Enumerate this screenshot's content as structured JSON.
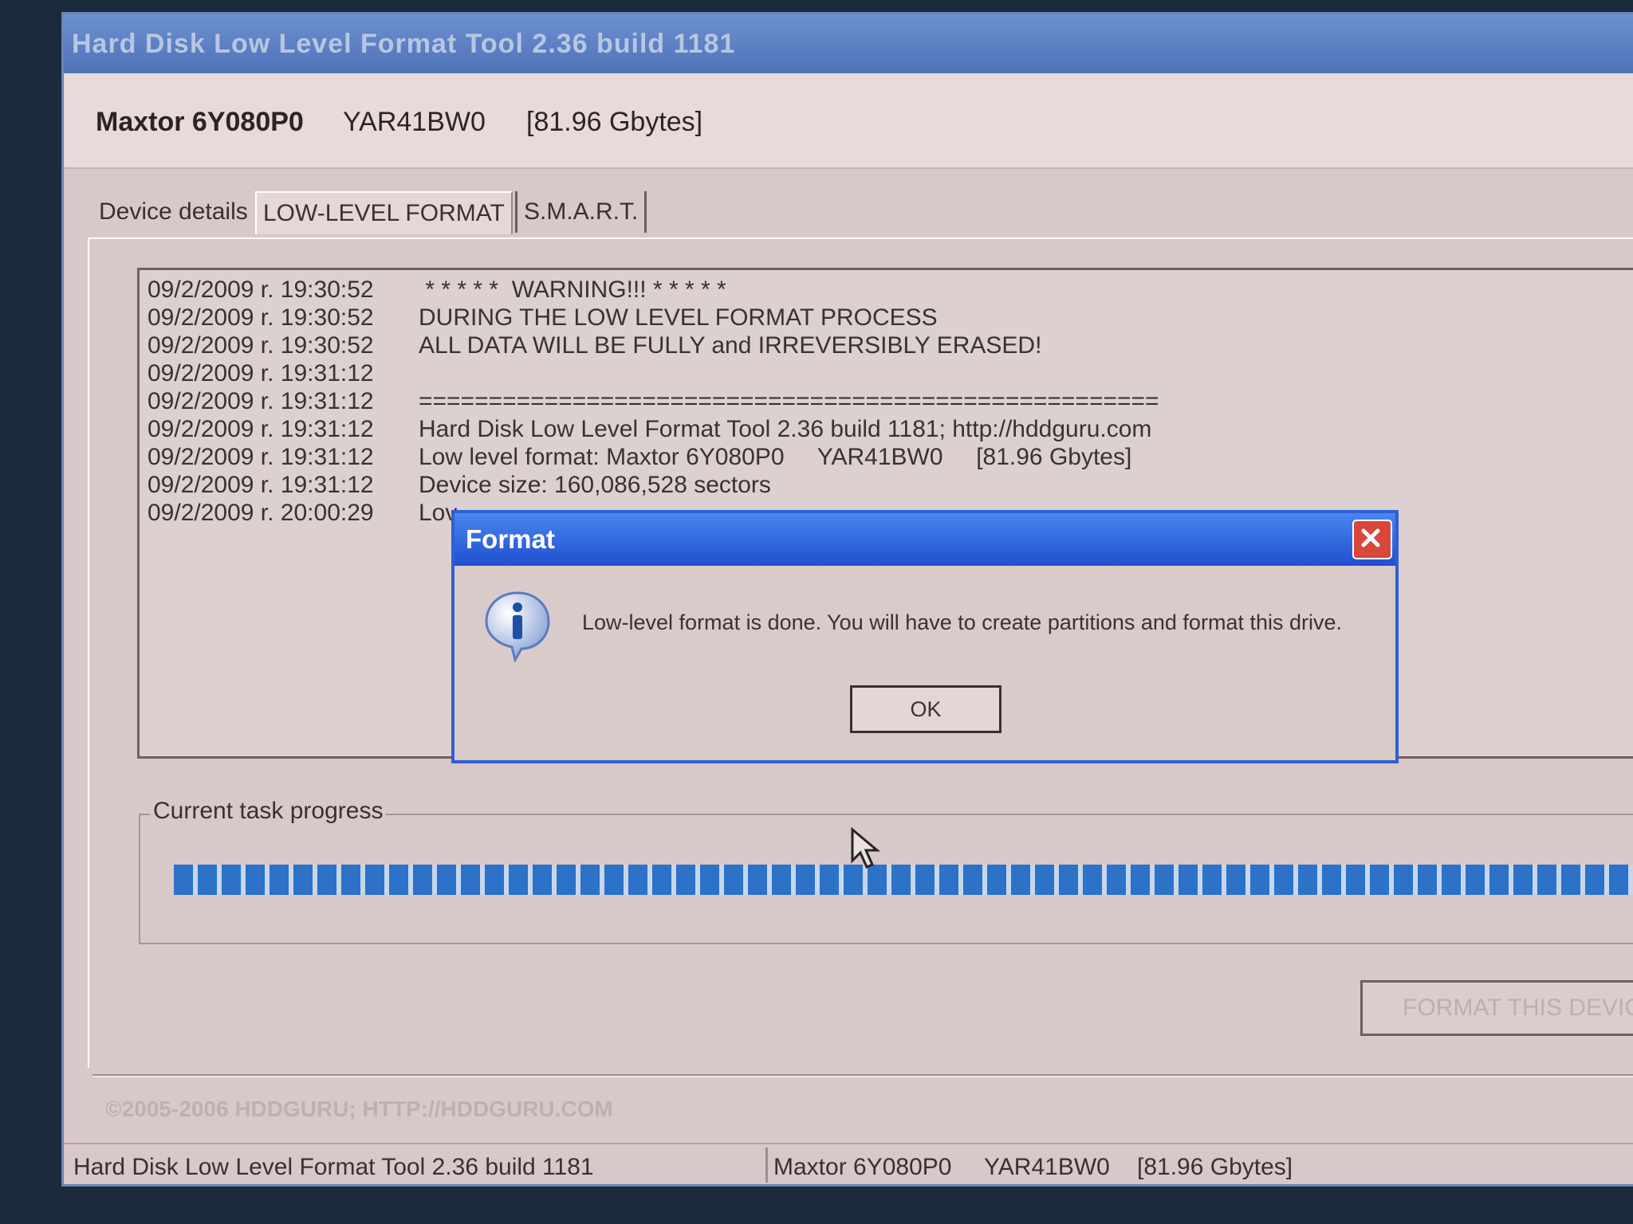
{
  "window": {
    "title": "Hard Disk Low Level Format Tool 2.36 build 1181"
  },
  "device": {
    "model": "Maxtor 6Y080P0",
    "firmware": "YAR41BW0",
    "size": "[81.96 Gbytes]"
  },
  "tabs": [
    "Device details",
    "LOW-LEVEL FORMAT",
    "S.M.A.R.T."
  ],
  "log": [
    {
      "time": "09/2/2009 r. 19:30:52",
      "msg": " * * * * *  WARNING!!! * * * * *"
    },
    {
      "time": "09/2/2009 r. 19:30:52",
      "msg": "DURING THE LOW LEVEL FORMAT PROCESS"
    },
    {
      "time": "09/2/2009 r. 19:30:52",
      "msg": "ALL DATA WILL BE FULLY and IRREVERSIBLY ERASED!"
    },
    {
      "time": "09/2/2009 r. 19:31:12",
      "msg": ""
    },
    {
      "time": "09/2/2009 r. 19:31:12",
      "msg": "====================================================="
    },
    {
      "time": "09/2/2009 r. 19:31:12",
      "msg": "Hard Disk Low Level Format Tool 2.36 build 1181; http://hddguru.com"
    },
    {
      "time": "09/2/2009 r. 19:31:12",
      "msg": "Low level format: Maxtor 6Y080P0     YAR41BW0     [81.96 Gbytes]"
    },
    {
      "time": "09/2/2009 r. 19:31:12",
      "msg": "Device size: 160,086,528 sectors"
    },
    {
      "time": "09/2/2009 r. 20:00:29",
      "msg": "Lov"
    }
  ],
  "progress": {
    "label": "Current task progress",
    "fraction": 1.0
  },
  "format_button": "FORMAT THIS DEVICE",
  "copyright": "©2005-2006 HDDGURU;  HTTP://HDDGURU.COM",
  "status": {
    "left": "Hard Disk Low Level Format Tool 2.36 build 1181",
    "model": "Maxtor 6Y080P0",
    "firmware": "YAR41BW0",
    "size": "[81.96 Gbytes]"
  },
  "dialog": {
    "title": "Format",
    "message": "Low-level format is done. You will have to create partitions and format this drive.",
    "ok": "OK"
  },
  "colors": {
    "progress": "#2b72c8",
    "dialog_title": "#2d5fd6",
    "close": "#d9463a"
  },
  "icons": [
    "info-icon",
    "close-icon",
    "mouse-cursor-icon"
  ]
}
